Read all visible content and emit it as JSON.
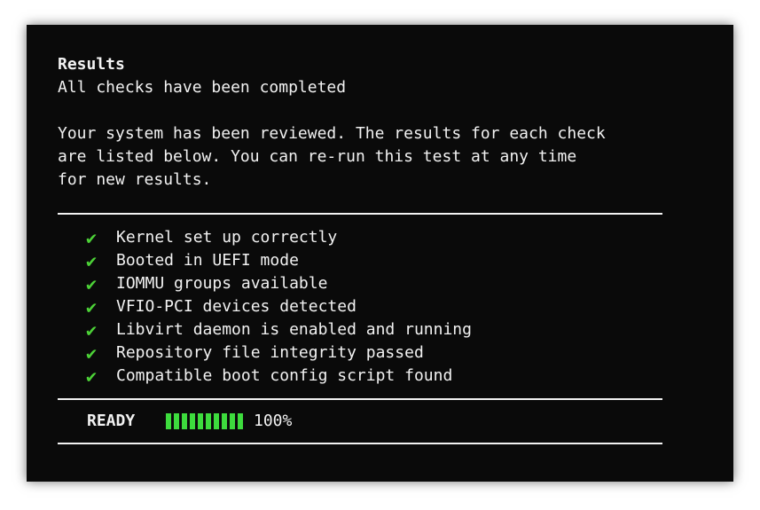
{
  "results": {
    "title": "Results",
    "subtitle": "All checks have been completed",
    "description_lines": [
      "Your system has been reviewed. The results for each check",
      "are listed below. You can re-run this test at any time",
      "for new results."
    ]
  },
  "checks": [
    {
      "icon": "check-icon",
      "label": "Kernel set up correctly"
    },
    {
      "icon": "check-icon",
      "label": "Booted in UEFI mode"
    },
    {
      "icon": "check-icon",
      "label": "IOMMU groups available"
    },
    {
      "icon": "check-icon",
      "label": "VFIO-PCI devices detected"
    },
    {
      "icon": "check-icon",
      "label": "Libvirt daemon is enabled and running"
    },
    {
      "icon": "check-icon",
      "label": "Repository file integrity passed"
    },
    {
      "icon": "check-icon",
      "label": "Compatible boot config script found"
    }
  ],
  "status": {
    "label": "READY",
    "progress_text": "100%",
    "progress_fraction": 1.0,
    "segments": 10
  },
  "colors": {
    "background": "#0a0a0a",
    "text": "#f2f2f2",
    "accent_green": "#3ddc3d"
  }
}
